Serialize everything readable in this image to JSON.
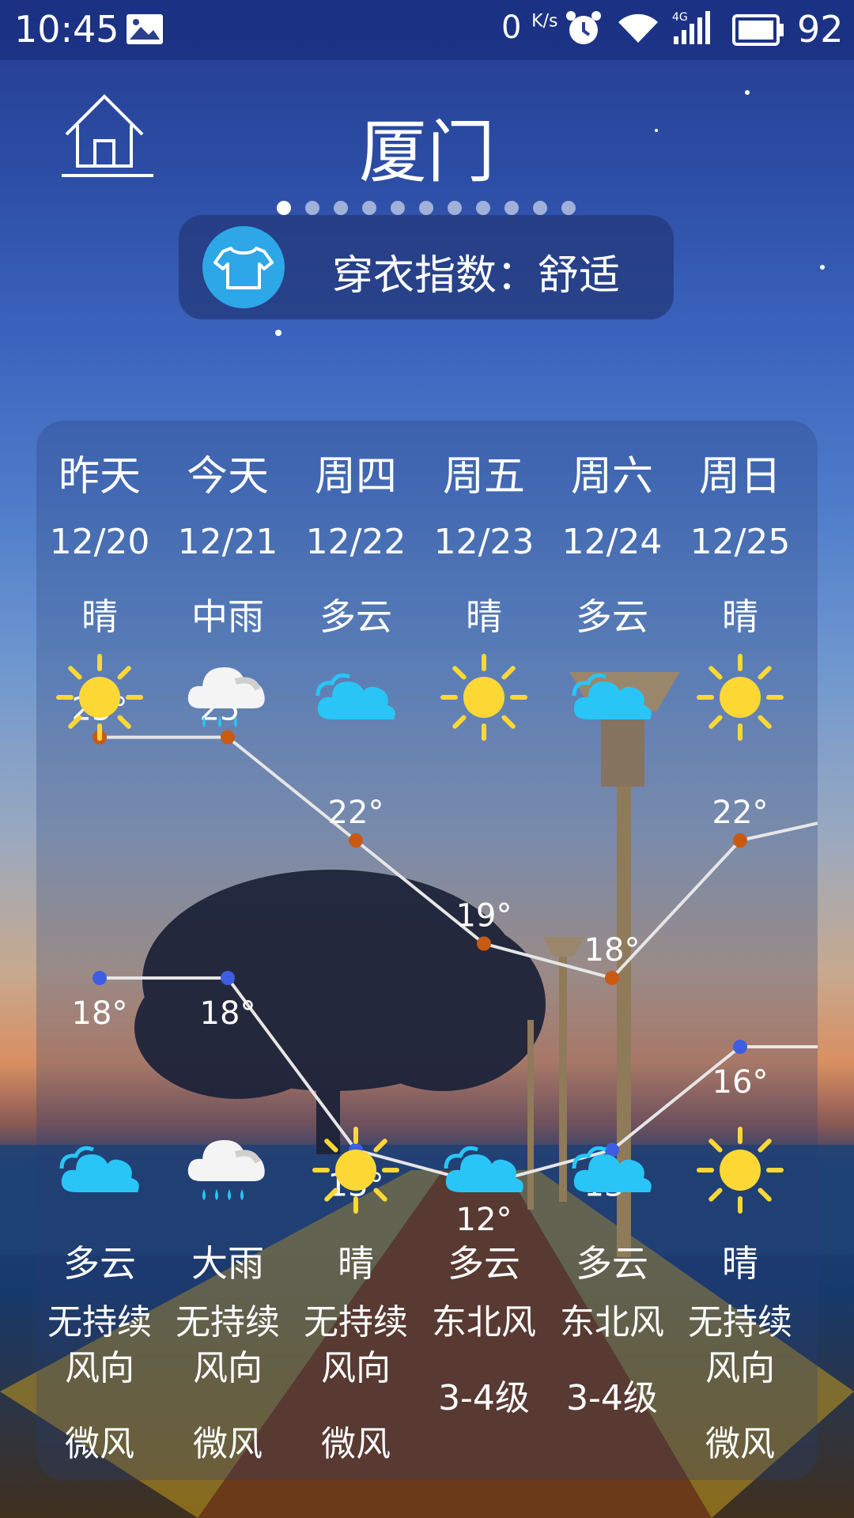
{
  "status_bar": {
    "time": "10:45",
    "net_speed": "0",
    "net_speed_unit": "K/s",
    "battery": "92",
    "icons": [
      "image-icon",
      "alarm-icon",
      "wifi-icon",
      "4g-signal-icon",
      "battery-icon"
    ]
  },
  "header": {
    "city": "厦门",
    "page_count": 11,
    "active_page": 0
  },
  "clothing_index": {
    "text": "穿衣指数：舒适",
    "icon": "tshirt-icon"
  },
  "forecast": {
    "days": [
      {
        "name": "昨天",
        "date": "12/20",
        "day_condition": "晴",
        "day_icon": "sun",
        "high": "25°",
        "low": "18°",
        "night_condition": "多云",
        "night_icon": "cloud",
        "wind_direction": "无持续风向",
        "wind_level": "微风"
      },
      {
        "name": "今天",
        "date": "12/21",
        "day_condition": "中雨",
        "day_icon": "rain-cloud",
        "high": "25°",
        "low": "18°",
        "night_condition": "大雨",
        "night_icon": "heavy-rain-cloud",
        "wind_direction": "无持续风向",
        "wind_level": "微风"
      },
      {
        "name": "周四",
        "date": "12/22",
        "day_condition": "多云",
        "day_icon": "cloud",
        "high": "22°",
        "low": "13°",
        "night_condition": "晴",
        "night_icon": "sun",
        "wind_direction": "无持续风向",
        "wind_level": "微风"
      },
      {
        "name": "周五",
        "date": "12/23",
        "day_condition": "晴",
        "day_icon": "sun",
        "high": "19°",
        "low": "12°",
        "night_condition": "多云",
        "night_icon": "cloud",
        "wind_direction": "东北风",
        "wind_level": "3-4级"
      },
      {
        "name": "周六",
        "date": "12/24",
        "day_condition": "多云",
        "day_icon": "cloud",
        "high": "18°",
        "low": "13°",
        "night_condition": "多云",
        "night_icon": "cloud",
        "wind_direction": "东北风",
        "wind_level": "3-4级"
      },
      {
        "name": "周日",
        "date": "12/25",
        "day_condition": "晴",
        "day_icon": "sun",
        "high": "22°",
        "low": "16°",
        "night_condition": "晴",
        "night_icon": "sun",
        "wind_direction": "无持续风向",
        "wind_level": "微风"
      }
    ]
  },
  "chart_data": {
    "type": "line",
    "categories": [
      "12/20",
      "12/21",
      "12/22",
      "12/23",
      "12/24",
      "12/25"
    ],
    "series": [
      {
        "values": [
          25,
          25,
          22,
          19,
          18,
          22
        ],
        "color": "#c85a14"
      },
      {
        "values": [
          18,
          18,
          13,
          12,
          13,
          16
        ],
        "color": "#3d5ee0"
      }
    ]
  },
  "colors": {
    "high_point": "#c85a14",
    "low_point": "#3d5ee0",
    "line": "#e6e6e6",
    "sun": "#fdd835",
    "cloud": "#29c5f6",
    "clothing_badge": "#2da7e8"
  }
}
